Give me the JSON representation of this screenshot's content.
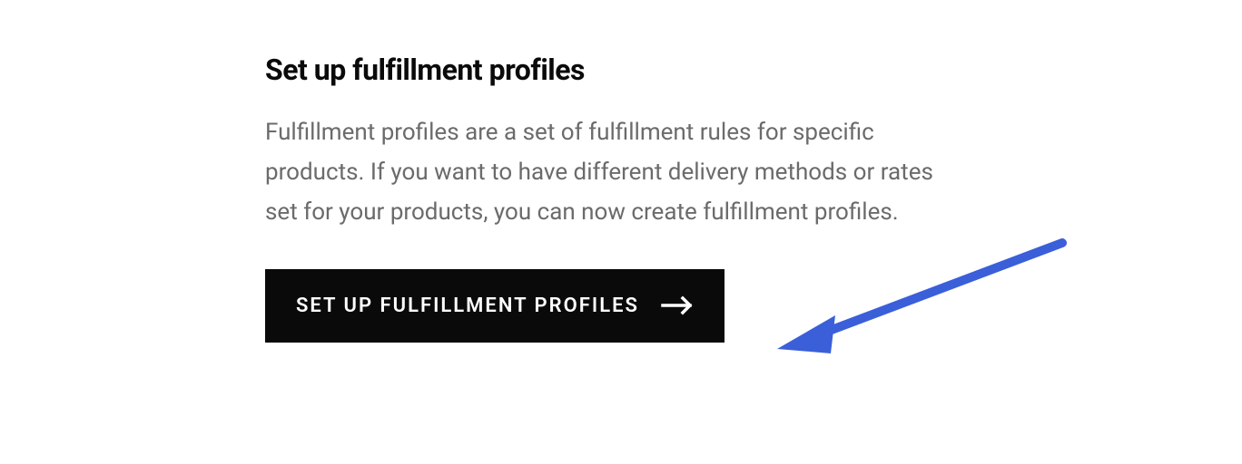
{
  "section": {
    "heading": "Set up fulfillment profiles",
    "description": "Fulfillment profiles are a set of fulfillment rules for specific products. If you want to have different delivery methods or rates set for your products, you can now create fulfillment profiles.",
    "button_label": "SET UP FULFILLMENT PROFILES"
  },
  "annotation": {
    "arrow_color": "#3b5fd9"
  }
}
